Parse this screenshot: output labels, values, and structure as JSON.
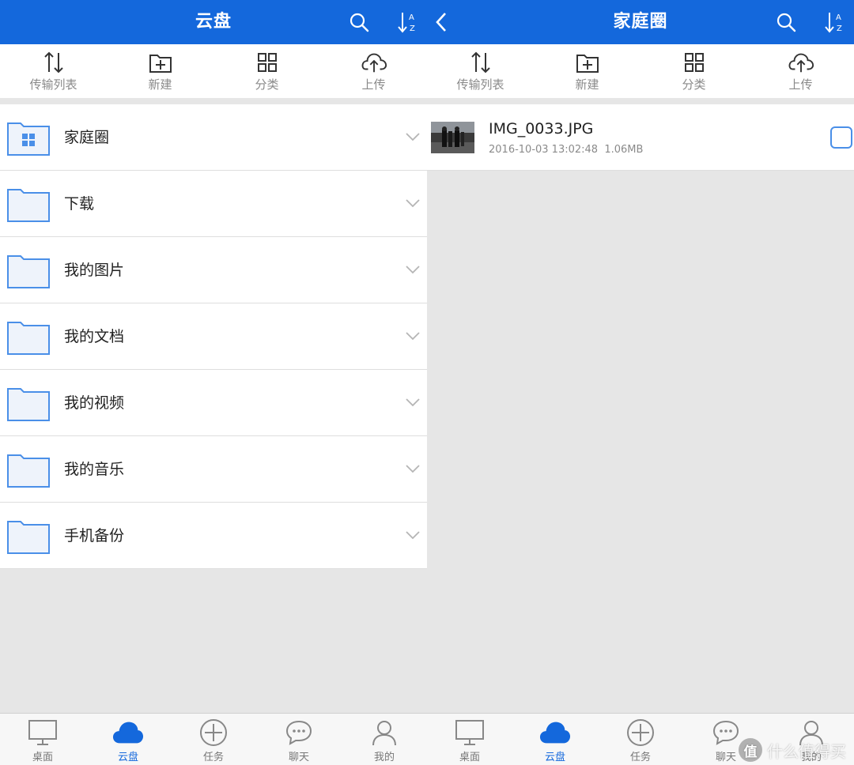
{
  "left": {
    "header": {
      "title": "云盘",
      "search_icon": "search-icon",
      "sort_icon": "sort-az-icon"
    },
    "toolbar": [
      {
        "label": "传输列表",
        "icon": "transfer-icon"
      },
      {
        "label": "新建",
        "icon": "new-folder-icon"
      },
      {
        "label": "分类",
        "icon": "category-grid-icon"
      },
      {
        "label": "上传",
        "icon": "cloud-upload-icon"
      }
    ],
    "folders": [
      {
        "name": "家庭圈",
        "icon": "family-folder-icon"
      },
      {
        "name": "下载",
        "icon": "folder-icon"
      },
      {
        "name": "我的图片",
        "icon": "folder-icon"
      },
      {
        "name": "我的文档",
        "icon": "folder-icon"
      },
      {
        "name": "我的视频",
        "icon": "folder-icon"
      },
      {
        "name": "我的音乐",
        "icon": "folder-icon"
      },
      {
        "name": "手机备份",
        "icon": "folder-icon"
      }
    ],
    "tabs": [
      {
        "label": "桌面",
        "icon": "monitor-icon",
        "active": false
      },
      {
        "label": "云盘",
        "icon": "cloud-icon",
        "active": true
      },
      {
        "label": "任务",
        "icon": "plus-circle-icon",
        "active": false
      },
      {
        "label": "聊天",
        "icon": "chat-bubble-icon",
        "active": false
      },
      {
        "label": "我的",
        "icon": "user-icon",
        "active": false
      }
    ]
  },
  "right": {
    "header": {
      "title": "家庭圈",
      "back_icon": "back-chevron-icon",
      "search_icon": "search-icon",
      "sort_icon": "sort-az-icon"
    },
    "toolbar": [
      {
        "label": "传输列表",
        "icon": "transfer-icon"
      },
      {
        "label": "新建",
        "icon": "new-folder-icon"
      },
      {
        "label": "分类",
        "icon": "category-grid-icon"
      },
      {
        "label": "上传",
        "icon": "cloud-upload-icon"
      }
    ],
    "files": [
      {
        "name": "IMG_0033.JPG",
        "date": "2016-10-03 13:02:48",
        "size": "1.06MB"
      }
    ],
    "tabs": [
      {
        "label": "桌面",
        "icon": "monitor-icon",
        "active": false
      },
      {
        "label": "云盘",
        "icon": "cloud-icon",
        "active": true
      },
      {
        "label": "任务",
        "icon": "plus-circle-icon",
        "active": false
      },
      {
        "label": "聊天",
        "icon": "chat-bubble-icon",
        "active": false
      },
      {
        "label": "我的",
        "icon": "user-icon",
        "active": false
      }
    ]
  },
  "watermark": {
    "text": "什么值得买",
    "icon_char": "值"
  },
  "colors": {
    "brand": "#1468dc",
    "background": "#e6e6e6",
    "folder_stroke": "#4a8fe8",
    "folder_fill": "#eef3fb"
  }
}
